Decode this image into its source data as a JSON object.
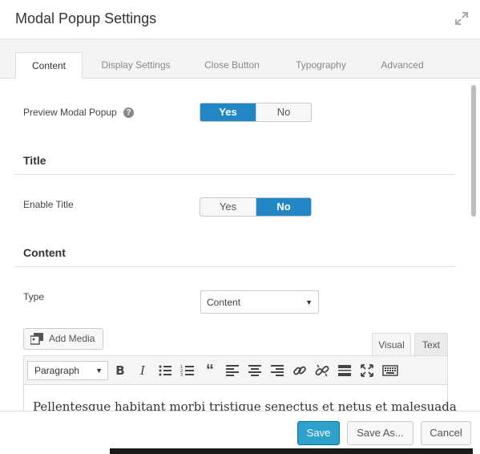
{
  "header": {
    "title": "Modal Popup Settings",
    "expand_icon": "expand-icon"
  },
  "tabs": [
    {
      "label": "Content",
      "active": true
    },
    {
      "label": "Display Settings",
      "active": false
    },
    {
      "label": "Close Button",
      "active": false
    },
    {
      "label": "Typography",
      "active": false
    },
    {
      "label": "Advanced",
      "active": false
    }
  ],
  "preview": {
    "label": "Preview Modal Popup",
    "yes": "Yes",
    "no": "No",
    "value": "Yes"
  },
  "title_section": {
    "heading": "Title",
    "enable_label": "Enable Title",
    "yes": "Yes",
    "no": "No",
    "value": "No"
  },
  "content_section": {
    "heading": "Content",
    "type_label": "Type",
    "type_value": "Content"
  },
  "editor": {
    "add_media": "Add Media",
    "tab_visual": "Visual",
    "tab_text": "Text",
    "active_tab": "Visual",
    "format_value": "Paragraph",
    "body_text": "Pellentesque habitant morbi tristique senectus et netus et malesuada",
    "toolbar_icons": [
      "bold-icon",
      "italic-icon",
      "bullet-list-icon",
      "numbered-list-icon",
      "blockquote-icon",
      "align-left-icon",
      "align-center-icon",
      "align-right-icon",
      "link-icon",
      "unlink-icon",
      "read-more-icon",
      "fullscreen-icon",
      "toolbar-toggle-icon"
    ]
  },
  "footer": {
    "save": "Save",
    "save_as": "Save As...",
    "cancel": "Cancel"
  },
  "colors": {
    "primary": "#2187c5",
    "save_button": "#2ea2cc"
  }
}
